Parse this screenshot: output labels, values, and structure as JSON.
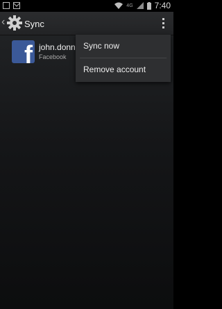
{
  "status_bar": {
    "network": "4G",
    "time": "7:40"
  },
  "action_bar": {
    "title": "Sync",
    "up_icon": "chevron-left-icon",
    "app_icon": "gear-icon",
    "overflow_icon": "overflow-menu-icon"
  },
  "account": {
    "name": "john.donn",
    "type": "Facebook",
    "icon": "facebook-icon",
    "brand_color": "#3b5998"
  },
  "overflow_menu": {
    "items": [
      {
        "label": "Sync now"
      },
      {
        "label": "Remove account"
      }
    ]
  }
}
